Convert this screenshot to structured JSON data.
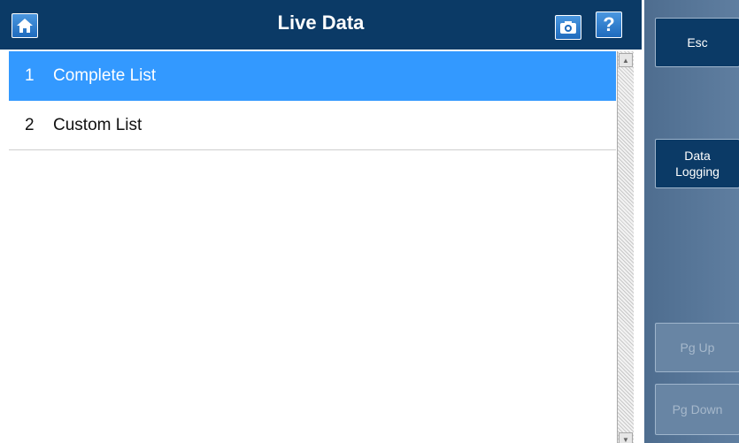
{
  "header": {
    "title": "Live Data",
    "home_icon": "home-icon",
    "camera_icon": "camera-icon",
    "help_label": "?"
  },
  "list": {
    "items": [
      {
        "number": "1",
        "label": "Complete List",
        "selected": true
      },
      {
        "number": "2",
        "label": "Custom List",
        "selected": false
      }
    ]
  },
  "sidebar": {
    "esc_label": "Esc",
    "data_logging_line1": "Data",
    "data_logging_line2": "Logging",
    "pg_up_label": "Pg Up",
    "pg_down_label": "Pg Down"
  },
  "colors": {
    "header_bg": "#0b3a66",
    "selected_row": "#3399ff",
    "sidebar_bg": "#5a789a"
  }
}
